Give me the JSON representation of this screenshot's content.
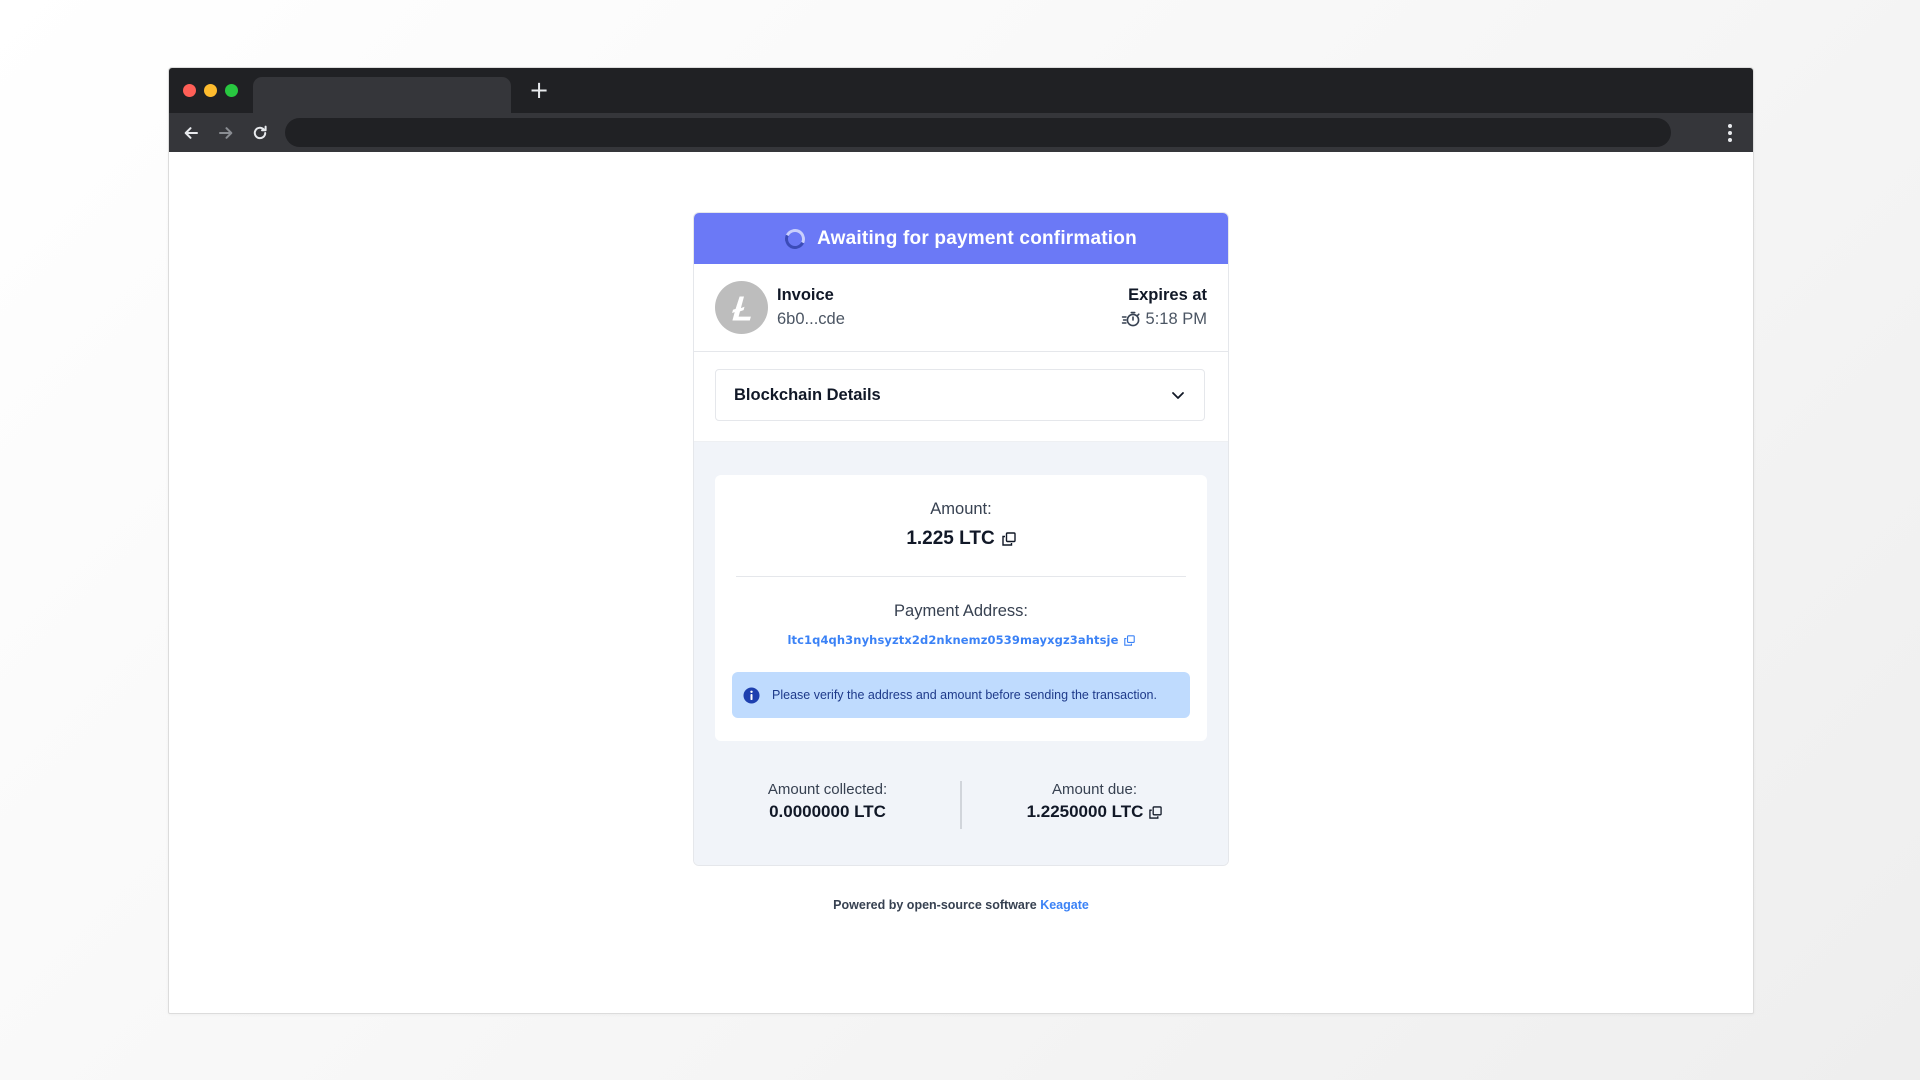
{
  "browser": {
    "new_tab_label": "+",
    "address_bar_value": ""
  },
  "status": {
    "text": "Awaiting for payment confirmation",
    "color": "#6b79f6"
  },
  "invoice": {
    "title": "Invoice",
    "id": "6b0...cde",
    "coin_icon": "litecoin-icon"
  },
  "expires": {
    "title": "Expires at",
    "time": "5:18 PM",
    "icon": "timer-icon"
  },
  "blockchain_details": {
    "title": "Blockchain Details",
    "expanded": false
  },
  "payment": {
    "amount_label": "Amount:",
    "amount_value": "1.225 LTC",
    "address_label": "Payment Address:",
    "address_value": "ltc1q4qh3nyhsyztx2d2nknemz0539mayxgz3ahtsje",
    "notice": "Please verify the address and amount before sending the transaction."
  },
  "summary": {
    "collected_label": "Amount collected:",
    "collected_value": "0.0000000 LTC",
    "due_label": "Amount due:",
    "due_value": "1.2250000 LTC"
  },
  "footer": {
    "text": "Powered by open-source software",
    "link_text": "Keagate",
    "link_color": "#3b82f6"
  }
}
